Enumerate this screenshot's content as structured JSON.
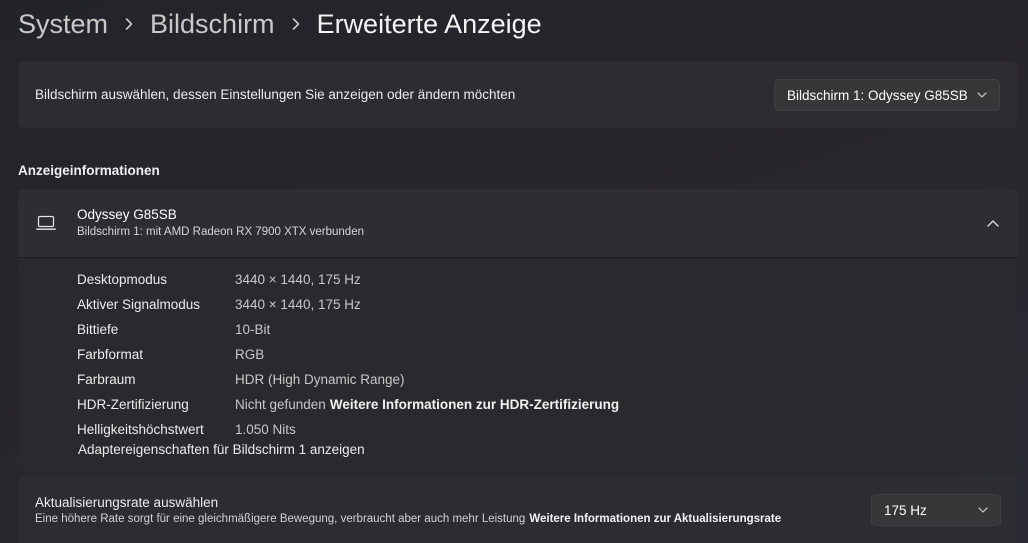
{
  "breadcrumb": {
    "items": [
      "System",
      "Bildschirm",
      "Erweiterte Anzeige"
    ]
  },
  "monitor_select": {
    "label": "Bildschirm auswählen, dessen Einstellungen Sie anzeigen oder ändern möchten",
    "selected": "Bildschirm 1: Odyssey G85SB"
  },
  "display_info": {
    "section_title": "Anzeigeinformationen",
    "device_name": "Odyssey G85SB",
    "device_subtitle": "Bildschirm 1: mit AMD Radeon RX 7900 XTX verbunden",
    "rows": [
      {
        "label": "Desktopmodus",
        "value": "3440 × 1440, 175 Hz"
      },
      {
        "label": "Aktiver Signalmodus",
        "value": "3440 × 1440, 175 Hz"
      },
      {
        "label": "Bittiefe",
        "value": "10-Bit"
      },
      {
        "label": "Farbformat",
        "value": "RGB"
      },
      {
        "label": "Farbraum",
        "value": "HDR (High Dynamic Range)"
      },
      {
        "label": "HDR-Zertifizierung",
        "value": "Nicht gefunden",
        "link": "Weitere Informationen zur HDR-Zertifizierung"
      },
      {
        "label": "Helligkeitshöchstwert",
        "value": "1.050 Nits"
      }
    ],
    "adapter_link": "Adaptereigenschaften für Bildschirm 1 anzeigen"
  },
  "refresh_rate": {
    "title": "Aktualisierungsrate auswählen",
    "description": "Eine höhere Rate sorgt für eine gleichmäßigere Bewegung, verbraucht aber auch mehr Leistung",
    "link": "Weitere Informationen zur Aktualisierungsrate",
    "selected": "175 Hz"
  },
  "icons": {
    "breadcrumb_separator": "chevron-right-icon",
    "dropdown": "chevron-down-icon",
    "device": "laptop-icon",
    "collapse": "chevron-up-icon"
  },
  "colors": {
    "background": "#27262b",
    "card": "#2d2d31",
    "card_body": "#2a2a2e",
    "dropdown": "#373739",
    "text_primary": "#ffffff",
    "text_secondary": "#c8c8c8"
  }
}
